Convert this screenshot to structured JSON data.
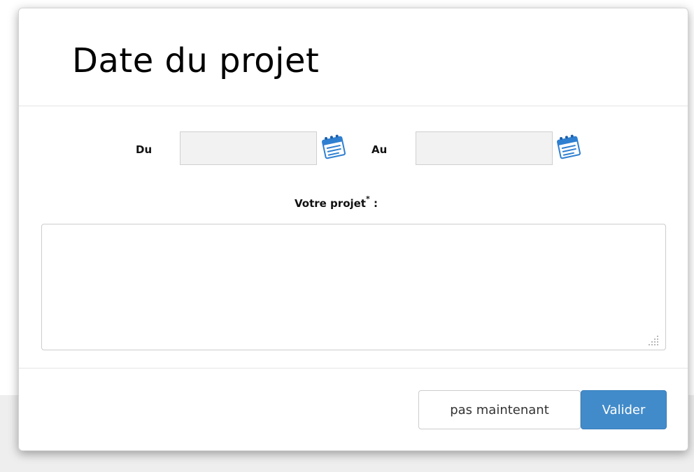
{
  "modal": {
    "title": "Date du projet"
  },
  "form": {
    "from_label": "Du",
    "from_value": "",
    "to_label": "Au",
    "to_value": "",
    "project_label": "Votre projet",
    "required_marker": "*",
    "project_label_suffix": " :",
    "project_value": ""
  },
  "footer": {
    "later_label": "pas maintenant",
    "submit_label": "Valider"
  },
  "colors": {
    "primary": "#428bca",
    "input_bg": "#f2f2f2",
    "calendar_icon_blue": "#2f7fd1"
  },
  "icons": {
    "from_picker": "calendar-icon",
    "to_picker": "calendar-icon",
    "textarea_grip": "resize-grip-icon"
  }
}
